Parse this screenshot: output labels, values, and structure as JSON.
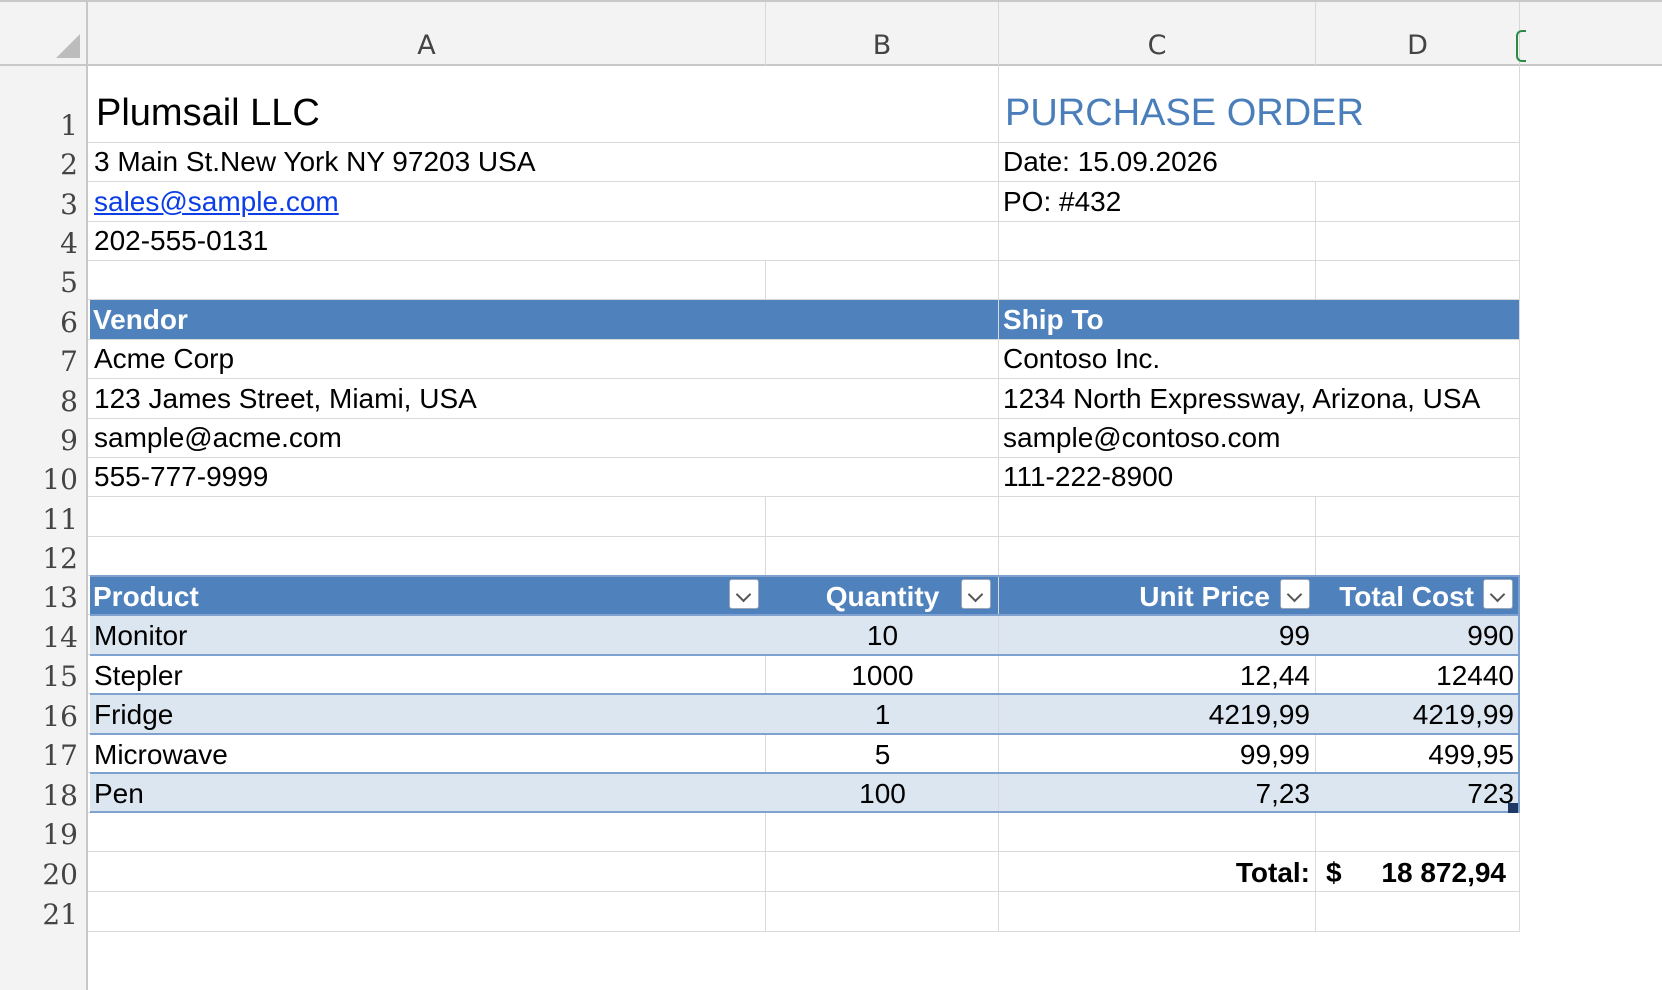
{
  "columns": [
    "A",
    "B",
    "C",
    "D"
  ],
  "rows": [
    "1",
    "2",
    "3",
    "4",
    "5",
    "6",
    "7",
    "8",
    "9",
    "10",
    "11",
    "12",
    "13",
    "14",
    "15",
    "16",
    "17",
    "18",
    "19",
    "20",
    "21"
  ],
  "company": {
    "name": "Plumsail LLC",
    "address": "3 Main St.New York NY 97203 USA",
    "email": "sales@sample.com",
    "phone": "202-555-0131"
  },
  "document": {
    "title": "PURCHASE ORDER",
    "date": "Date: 15.09.2026",
    "po": "PO: #432"
  },
  "vendor": {
    "heading": "Vendor",
    "name": "Acme Corp",
    "address": "123 James Street, Miami, USA",
    "email": "sample@acme.com",
    "phone": "555-777-9999"
  },
  "ship_to": {
    "heading": "Ship To",
    "name": "Contoso Inc.",
    "address": "1234 North Expressway, Arizona, USA",
    "email": "sample@contoso.com",
    "phone": "111-222-8900"
  },
  "table": {
    "headers": [
      "Product",
      "Quantity",
      "Unit Price",
      "Total Cost"
    ],
    "rows": [
      [
        "Monitor",
        "10",
        "99",
        "990"
      ],
      [
        "Stepler",
        "1000",
        "12,44",
        "12440"
      ],
      [
        "Fridge",
        "1",
        "4219,99",
        "4219,99"
      ],
      [
        "Microwave",
        "5",
        "99,99",
        "499,95"
      ],
      [
        "Pen",
        "100",
        "7,23",
        "723"
      ]
    ]
  },
  "total": {
    "label": "Total:",
    "currency": "$",
    "value": "18 872,94"
  },
  "colors": {
    "header_band": "#4f81bd",
    "banded_row": "#dce6f1",
    "title_blue": "#4a7ebb",
    "link": "#0b3ee6"
  }
}
